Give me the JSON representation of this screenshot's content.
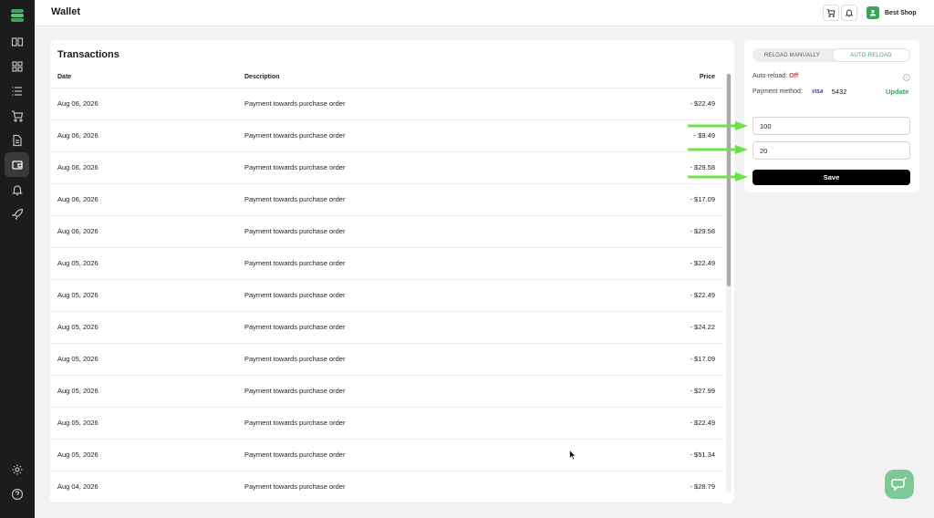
{
  "header": {
    "title": "Wallet",
    "shop_name": "Best Shop"
  },
  "sidebar": {
    "items": [
      {
        "icon": "book-icon"
      },
      {
        "icon": "dashboard-icon"
      },
      {
        "icon": "list-icon"
      },
      {
        "icon": "cart-icon"
      },
      {
        "icon": "document-icon"
      },
      {
        "icon": "wallet-icon",
        "active": true
      },
      {
        "icon": "bell-icon"
      },
      {
        "icon": "rocket-icon"
      }
    ],
    "bottom": [
      {
        "icon": "gear-icon"
      },
      {
        "icon": "help-icon"
      }
    ]
  },
  "transactions": {
    "title": "Transactions",
    "columns": {
      "date": "Date",
      "description": "Description",
      "price": "Price"
    },
    "rows": [
      {
        "date": "Aug 06, 2026",
        "description": "Payment towards purchase order",
        "price": "- $22.49"
      },
      {
        "date": "Aug 06, 2026",
        "description": "Payment towards purchase order",
        "price": "- $9.49"
      },
      {
        "date": "Aug 06, 2026",
        "description": "Payment towards purchase order",
        "price": "- $29.58"
      },
      {
        "date": "Aug 06, 2026",
        "description": "Payment towards purchase order",
        "price": "- $17.09"
      },
      {
        "date": "Aug 06, 2026",
        "description": "Payment towards purchase order",
        "price": "- $29.58"
      },
      {
        "date": "Aug 05, 2026",
        "description": "Payment towards purchase order",
        "price": "- $22.49"
      },
      {
        "date": "Aug 05, 2026",
        "description": "Payment towards purchase order",
        "price": "- $22.49"
      },
      {
        "date": "Aug 05, 2026",
        "description": "Payment towards purchase order",
        "price": "- $24.22"
      },
      {
        "date": "Aug 05, 2026",
        "description": "Payment towards purchase order",
        "price": "- $17.09"
      },
      {
        "date": "Aug 05, 2026",
        "description": "Payment towards purchase order",
        "price": "- $27.99"
      },
      {
        "date": "Aug 05, 2026",
        "description": "Payment towards purchase order",
        "price": "- $22.49"
      },
      {
        "date": "Aug 05, 2026",
        "description": "Payment towards purchase order",
        "price": "- $51.34"
      },
      {
        "date": "Aug 04, 2026",
        "description": "Payment towards purchase order",
        "price": "- $28.79"
      }
    ]
  },
  "reload": {
    "tab_manual": "RELOAD MANUALLY",
    "tab_auto": "AUTO-RELOAD",
    "status_label": "Auto-reload:",
    "status_value": "Off",
    "payment_label": "Payment method:",
    "card_brand": "VISA",
    "card_last4": "5432",
    "update_label": "Update",
    "threshold_value": "100",
    "amount_value": "20",
    "save_label": "Save"
  },
  "colors": {
    "accent": "#3aa657",
    "off": "#e03a3a",
    "arrow": "#6fe04a",
    "sidebar": "#1c1c1c"
  }
}
